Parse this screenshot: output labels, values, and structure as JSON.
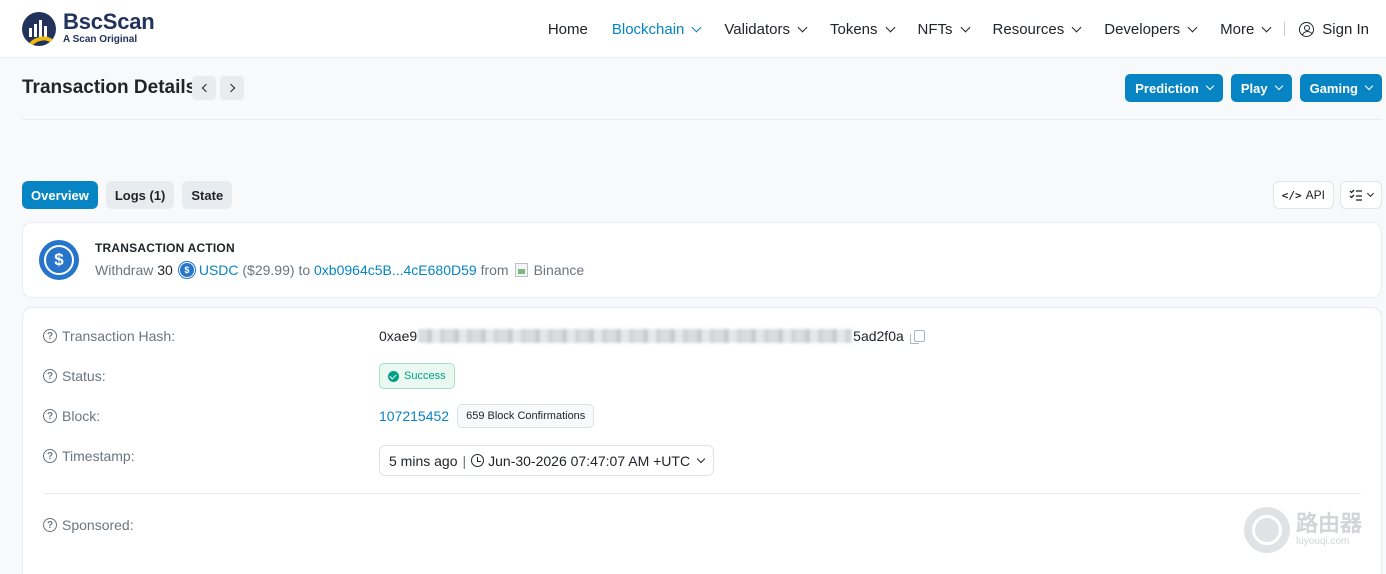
{
  "brand": {
    "name": "BscScan",
    "tagline": "A Scan Original"
  },
  "nav": {
    "items": [
      {
        "label": "Home",
        "dropdown": false,
        "active": false
      },
      {
        "label": "Blockchain",
        "dropdown": true,
        "active": true
      },
      {
        "label": "Validators",
        "dropdown": true,
        "active": false
      },
      {
        "label": "Tokens",
        "dropdown": true,
        "active": false
      },
      {
        "label": "NFTs",
        "dropdown": true,
        "active": false
      },
      {
        "label": "Resources",
        "dropdown": true,
        "active": false
      },
      {
        "label": "Developers",
        "dropdown": true,
        "active": false
      },
      {
        "label": "More",
        "dropdown": true,
        "active": false
      }
    ],
    "signin_label": "Sign In"
  },
  "page": {
    "title": "Transaction Details"
  },
  "promo_buttons": [
    "Prediction",
    "Play",
    "Gaming"
  ],
  "tabs": [
    {
      "label": "Overview",
      "active": true
    },
    {
      "label": "Logs (1)",
      "active": false
    },
    {
      "label": "State",
      "active": false
    }
  ],
  "tools": {
    "api_label": "API"
  },
  "action": {
    "heading": "TRANSACTION ACTION",
    "verb": "Withdraw",
    "amount": "30",
    "token": "USDC",
    "usd_value": "($29.99)",
    "to_word": "to",
    "to_address": "0xb0964c5B...4cE680D59",
    "from_word": "from",
    "from_name": "Binance"
  },
  "details": {
    "hash_label": "Transaction Hash:",
    "hash_prefix": "0xae9",
    "hash_suffix": "5ad2f0a",
    "status_label": "Status:",
    "status_value": "Success",
    "block_label": "Block:",
    "block_number": "107215452",
    "block_confirmations": "659 Block Confirmations",
    "timestamp_label": "Timestamp:",
    "timestamp_relative": "5 mins ago",
    "timestamp_absolute": "Jun-30-2026 07:47:07 AM +UTC",
    "sponsored_label": "Sponsored:"
  },
  "watermark": {
    "text": "路由器",
    "url": "luyouqi.com"
  },
  "colors": {
    "accent": "#0784c3",
    "success": "#00a186",
    "usdc": "#2775ca",
    "brand_dark": "#21325b",
    "brand_gold": "#f0b90b"
  }
}
